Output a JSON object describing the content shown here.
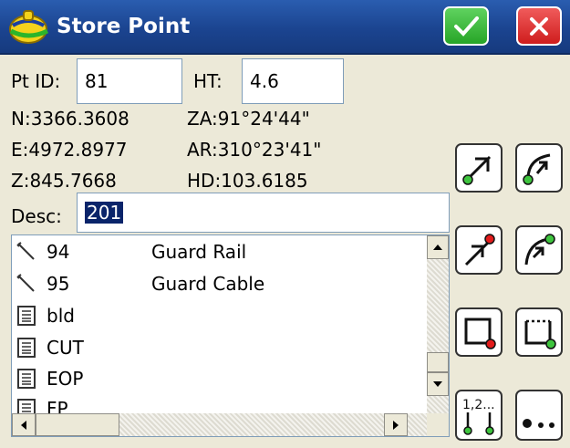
{
  "window": {
    "title": "Store Point"
  },
  "form": {
    "pt_id_label": "Pt ID:",
    "pt_id_value": "81",
    "ht_label": "HT:",
    "ht_value": "4.6",
    "n_text": "N:3366.3608",
    "za_text": "ZA:91°24'44\"",
    "e_text": "E:4972.8977",
    "ar_text": "AR:310°23'41\"",
    "z_text": "Z:845.7668",
    "hd_text": "HD:103.6185",
    "desc_label": "Desc:",
    "desc_value": "201"
  },
  "list": {
    "items": [
      {
        "icon": "line-code-icon",
        "code": "94",
        "description": "Guard Rail"
      },
      {
        "icon": "line-code-icon",
        "code": "95",
        "description": "Guard Cable"
      },
      {
        "icon": "point-code-icon",
        "code": "bld",
        "description": ""
      },
      {
        "icon": "point-code-icon",
        "code": "CUT",
        "description": ""
      },
      {
        "icon": "point-code-icon",
        "code": "EOP",
        "description": ""
      },
      {
        "icon": "point-code-icon",
        "code": "FP",
        "description": ""
      }
    ]
  },
  "tools": [
    "line-start-icon",
    "arc-start-icon",
    "line-end-icon",
    "arc-end-icon",
    "rect-corner-icon",
    "rect-close-icon",
    "numbered-points-icon",
    "multi-point-icon"
  ],
  "colors": {
    "title_bar": "#1b4490",
    "ok": "#27a527",
    "cancel": "#cf1d1d",
    "node_green": "#3ec43e",
    "node_red": "#e21b1b"
  }
}
